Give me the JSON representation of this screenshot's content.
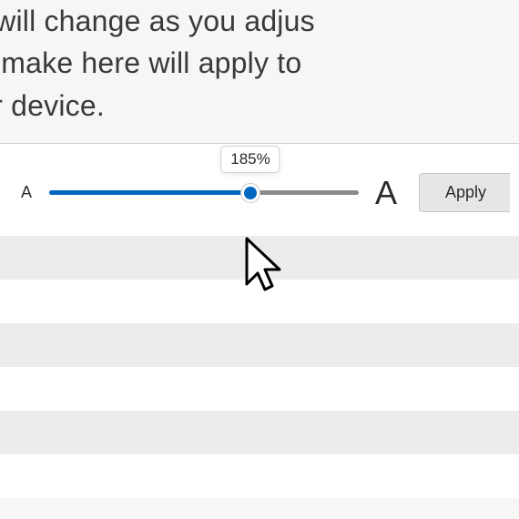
{
  "description": {
    "line1": "rds will change as you adjus",
    "line2": "you make here will apply to",
    "line3": "your device."
  },
  "slider": {
    "label_small": "A",
    "label_large": "A",
    "value_percent": 65,
    "tooltip": "185%"
  },
  "apply_button": {
    "label": "Apply"
  },
  "colors": {
    "accent": "#0067c0"
  }
}
